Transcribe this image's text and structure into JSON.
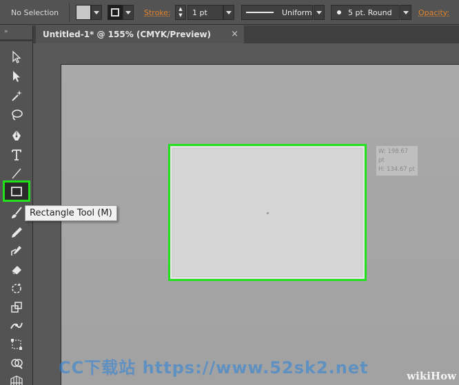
{
  "control_bar": {
    "selection_label": "No Selection",
    "stroke_label": "Stroke:",
    "stroke_weight": "1 pt",
    "profile_label": "Uniform",
    "brush_label": "5 pt. Round",
    "opacity_label": "Opacity:",
    "fill_color": "#c8c8c8"
  },
  "document": {
    "tab_title": "Untitled-1* @ 155% (CMYK/Preview)",
    "close_glyph": "×"
  },
  "tools": {
    "grip": "»",
    "tooltip": "Rectangle Tool (M)",
    "highlight_color": "#21e21a"
  },
  "canvas": {
    "width_readout": "W: 198.67 pt",
    "height_readout": "H: 134.67 pt"
  },
  "watermarks": {
    "site": "CC下载站 https://www.52sk2.net",
    "wiki": "wiki",
    "how": "How"
  }
}
